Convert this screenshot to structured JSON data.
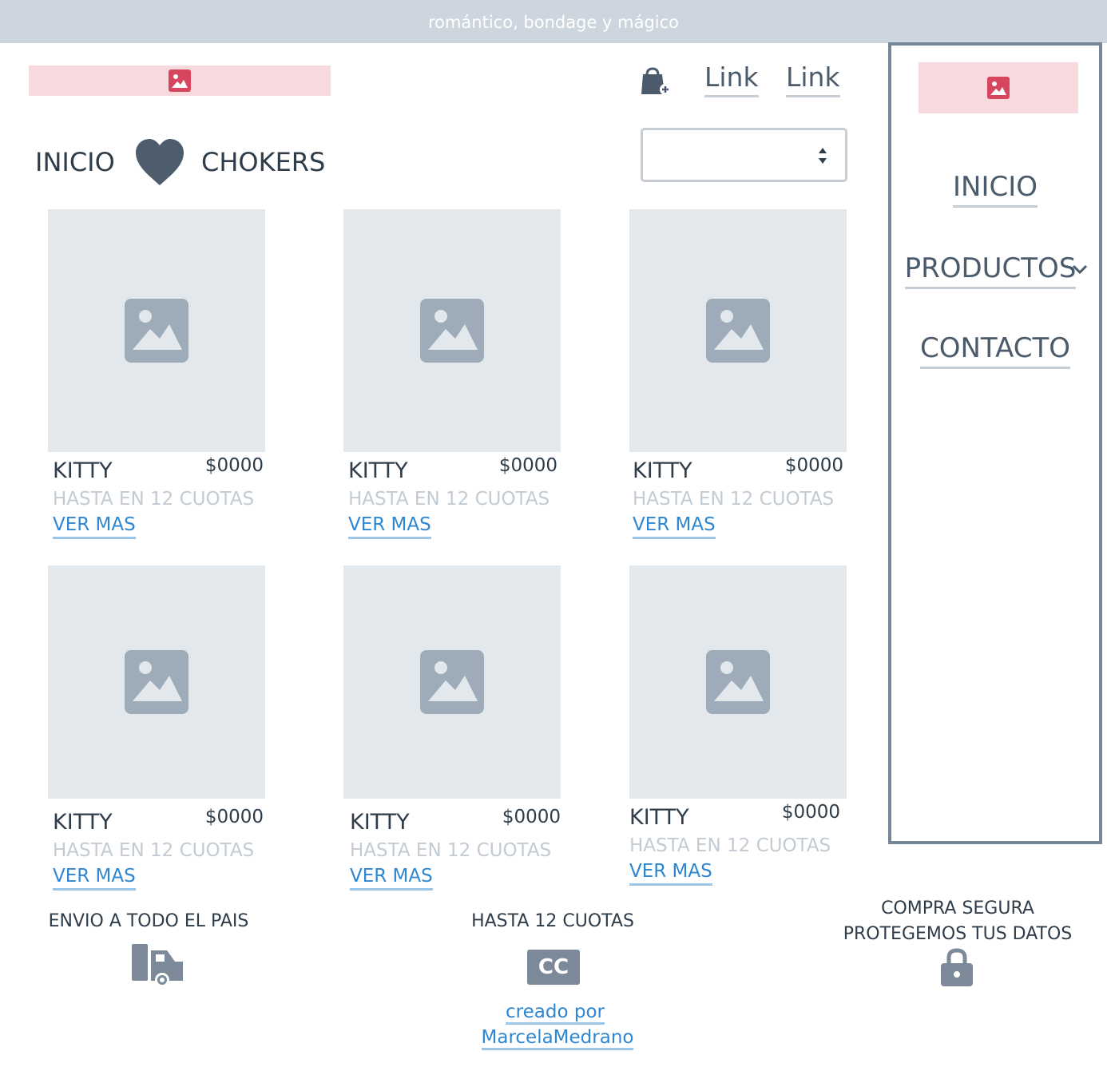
{
  "topbar": {
    "text": "romántico, bondage y mágico"
  },
  "header": {
    "links": [
      "Link",
      "Link"
    ]
  },
  "breadcrumb": {
    "home": "INICIO",
    "current": "CHOKERS"
  },
  "sidebar": {
    "items": [
      {
        "label": "INICIO"
      },
      {
        "label": "PRODUCTOS"
      },
      {
        "label": "CONTACTO"
      }
    ]
  },
  "products": [
    {
      "name": "KITTY",
      "price": "$0000",
      "installments": "HASTA EN 12 CUOTAS",
      "more": "VER MAS"
    },
    {
      "name": "KITTY",
      "price": "$0000",
      "installments": "HASTA EN 12 CUOTAS",
      "more": "VER MAS"
    },
    {
      "name": "KITTY",
      "price": "$0000",
      "installments": "HASTA EN 12 CUOTAS",
      "more": "VER MAS"
    },
    {
      "name": "KITTY",
      "price": "$0000",
      "installments": "HASTA EN 12 CUOTAS",
      "more": "VER MAS"
    },
    {
      "name": "KITTY",
      "price": "$0000",
      "installments": "HASTA EN 12 CUOTAS",
      "more": "VER MAS"
    },
    {
      "name": "KITTY",
      "price": "$0000",
      "installments": "HASTA EN 12 CUOTAS",
      "more": "VER MAS"
    }
  ],
  "features": {
    "shipping": "ENVIO A TODO EL PAIS",
    "installments": "HASTA 12 CUOTAS",
    "card_badge": "CC",
    "secure_line1": "COMPRA SEGURA",
    "secure_line2": "PROTEGEMOS TUS DATOS"
  },
  "credit": {
    "line1": "creado por",
    "line2": "MarcelaMedrano"
  },
  "colors": {
    "topbar": "#cdd6de",
    "accent_pink": "#f6dade",
    "logo_icon": "#d8455e",
    "link_blue": "#2f86d1",
    "icon_gray": "#7b8999",
    "sidebar_border": "#758696"
  },
  "icons": [
    "image-icon",
    "cart-icon",
    "heart-icon",
    "chevron-down-icon",
    "truck-icon",
    "credit-card-icon",
    "lock-icon",
    "select-arrows-icon"
  ]
}
